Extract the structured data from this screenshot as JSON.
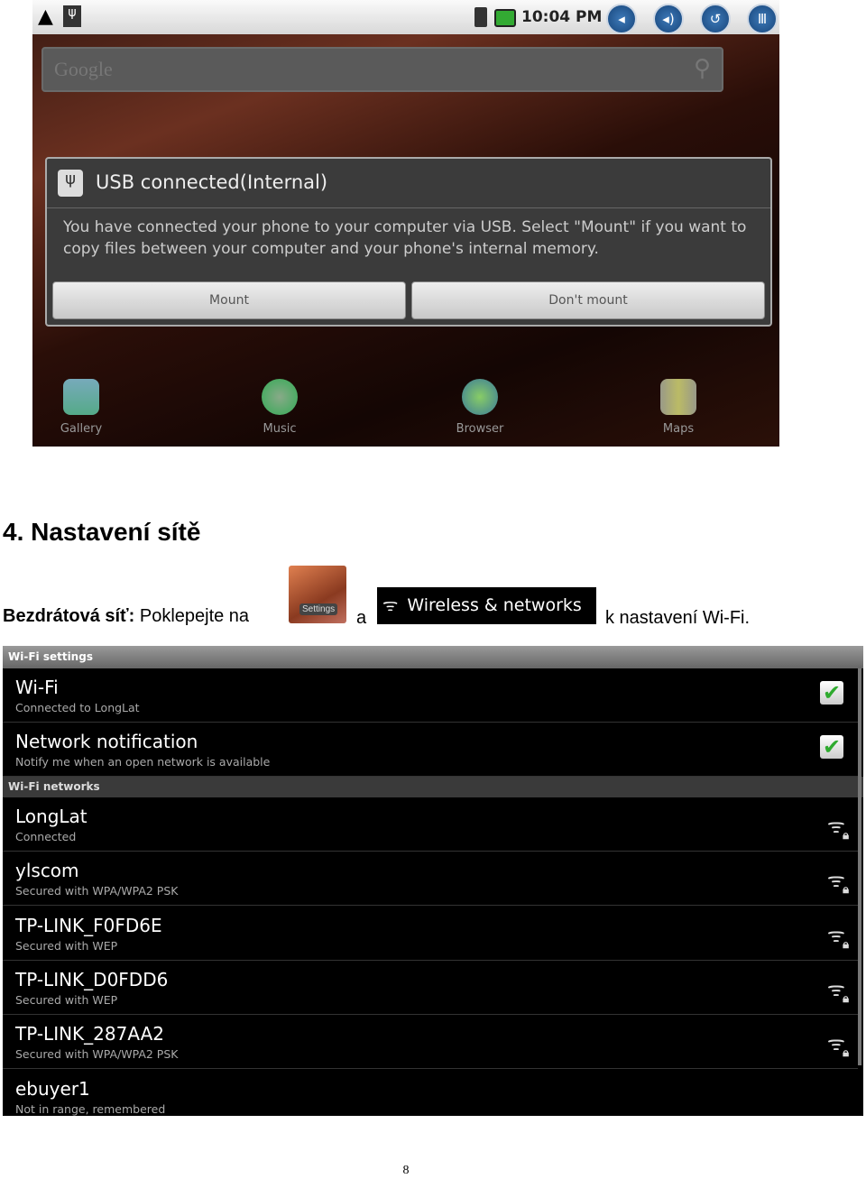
{
  "screenshot1": {
    "status_time": "10:04 PM",
    "search_placeholder": "Google",
    "dialog": {
      "title": "USB connected(Internal)",
      "message": "You have connected your phone to your computer via USB. Select \"Mount\" if you want to copy files between your computer and your phone's internal memory.",
      "mount": "Mount",
      "dont_mount": "Don't mount"
    },
    "apps": [
      "Gallery",
      "Music",
      "Browser",
      "Maps"
    ]
  },
  "heading": "4. Nastavení sítě",
  "paragraph": {
    "bold": "Bezdrátová síť:",
    "text1": " Poklepejte na",
    "settings_icon_label": "Settings",
    "text2": "a",
    "wireless_label": "Wireless & networks",
    "text3": "k nastavení Wi-Fi."
  },
  "screenshot2": {
    "header1": "Wi-Fi settings",
    "wifi": {
      "title": "Wi-Fi",
      "sub": "Connected to LongLat",
      "checked": true
    },
    "notif": {
      "title": "Network notification",
      "sub": "Notify me when an open network is available",
      "checked": true
    },
    "header2": "Wi-Fi networks",
    "networks": [
      {
        "name": "LongLat",
        "status": "Connected"
      },
      {
        "name": "ylscom",
        "status": "Secured with WPA/WPA2 PSK"
      },
      {
        "name": "TP-LINK_F0FD6E",
        "status": "Secured with WEP"
      },
      {
        "name": "TP-LINK_D0FDD6",
        "status": "Secured with WEP"
      },
      {
        "name": "TP-LINK_287AA2",
        "status": "Secured with WPA/WPA2 PSK"
      },
      {
        "name": "ebuyer1",
        "status": "Not in range, remembered"
      }
    ]
  },
  "page_number": "8"
}
